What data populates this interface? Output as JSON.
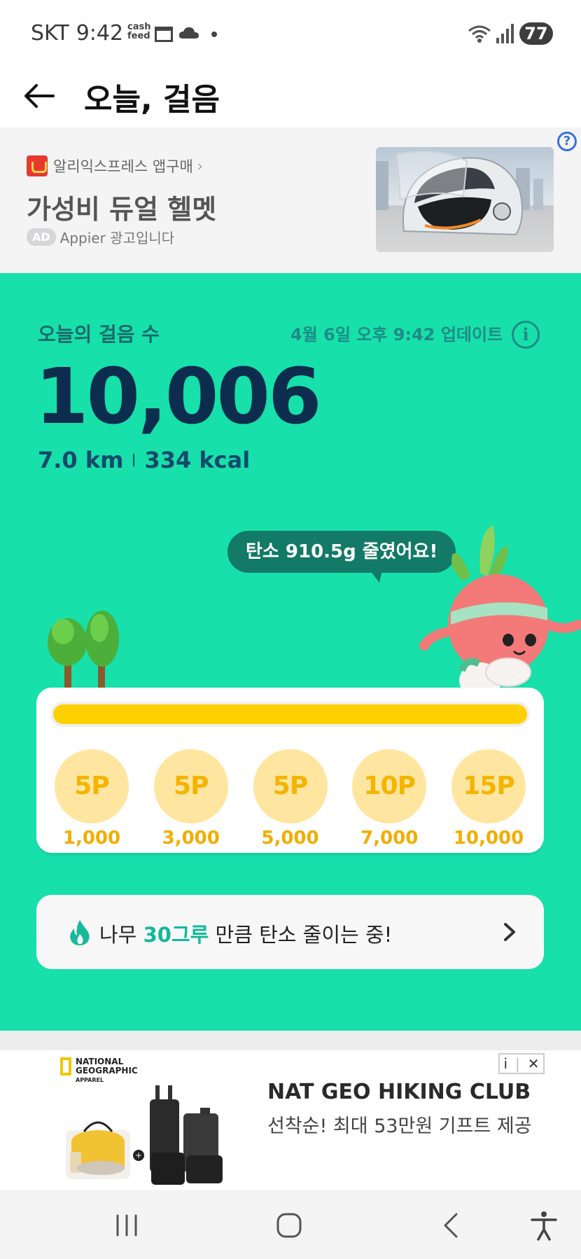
{
  "status_bar": {
    "carrier": "SKT",
    "time": "9:42",
    "app_badge": "cash feed",
    "battery": "77",
    "icons": [
      "cashfeed-icon",
      "calendar-icon",
      "cloud-icon",
      "dot-icon",
      "wifi-icon",
      "signal-icon",
      "battery-icon"
    ]
  },
  "app_bar": {
    "title": "오늘, 걸음",
    "back_icon": "arrow-left-icon"
  },
  "top_ad": {
    "brand": "알리익스프레스 앱구매",
    "brand_arrow": "›",
    "headline": "가성비 듀얼 헬멧",
    "badge": "AD",
    "sponsor": "Appier 광고입니다",
    "help": "?"
  },
  "steps": {
    "label": "오늘의 걸음 수",
    "updated": "4월 6일 오후 9:42 업데이트",
    "info": "i",
    "count": "10,006",
    "distance": "7.0 km",
    "calories": "334 kcal",
    "carbon_message": "탄소 910.5g 줄였어요!"
  },
  "rewards": {
    "progress": 1.0,
    "milestones": [
      {
        "points": "5P",
        "steps": "1,000"
      },
      {
        "points": "5P",
        "steps": "3,000"
      },
      {
        "points": "5P",
        "steps": "5,000"
      },
      {
        "points": "10P",
        "steps": "7,000"
      },
      {
        "points": "15P",
        "steps": "10,000"
      }
    ]
  },
  "tree_banner": {
    "prefix": "나무 ",
    "highlight": "30그루",
    "suffix": " 만큼 탄소 줄이는 중!"
  },
  "bottom_ad": {
    "logo_line1": "NATIONAL",
    "logo_line2": "GEOGRAPHIC",
    "logo_line3": "APPAREL",
    "info": "i",
    "close": "✕",
    "title": "NAT GEO HIKING CLUB",
    "description": "선착순! 최대 53만원 기프트 제공"
  },
  "nav_bar": {
    "items": [
      "recent-apps-icon",
      "home-icon",
      "back-icon",
      "accessibility-icon"
    ]
  },
  "colors": {
    "green_bg": "#17e0aa",
    "navy": "#0c2d4e",
    "bubble": "#127a66",
    "progress": "#ffd000",
    "coin": "#ffe6a0",
    "coin_text": "#f4b400"
  }
}
